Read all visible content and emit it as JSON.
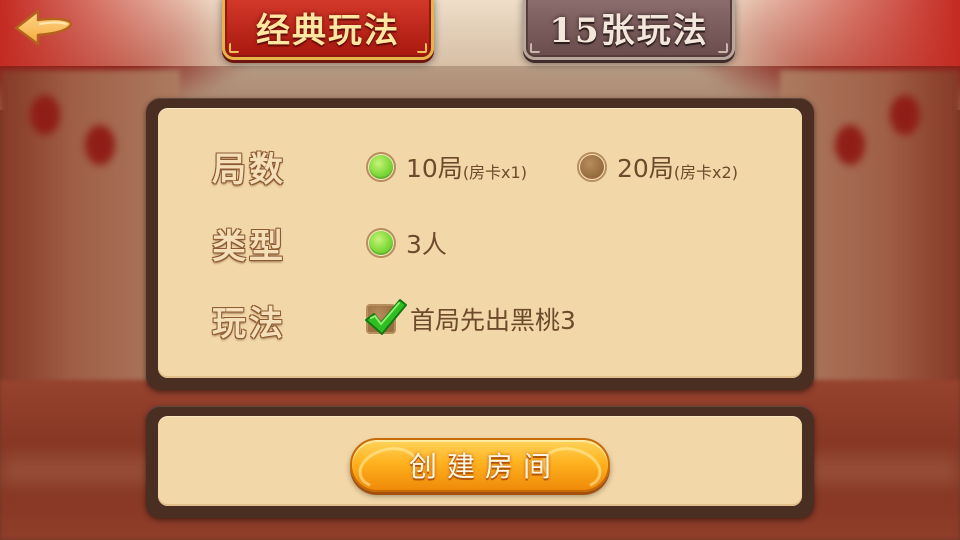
{
  "tabs": [
    {
      "label": "经典玩法",
      "state": "active"
    },
    {
      "label": "15张玩法",
      "state": "inactive"
    }
  ],
  "back_icon": "left-arrow-icon",
  "options": {
    "rounds": {
      "label": "局数",
      "choices": [
        {
          "text": "10局",
          "sub": "(房卡x1)",
          "selected": true
        },
        {
          "text": "20局",
          "sub": "(房卡x2)",
          "selected": false
        }
      ]
    },
    "type": {
      "label": "类型",
      "choices": [
        {
          "text": "3人",
          "selected": true
        }
      ]
    },
    "play": {
      "label": "玩法",
      "checkbox": {
        "text": "首局先出黑桃3",
        "checked": true
      }
    }
  },
  "create_button": {
    "label": "创建房间"
  },
  "colors": {
    "panel": "#f2d7a8",
    "panel_border": "#4a2e22",
    "selected_green": "#7dd93a",
    "active_tab_red": "#c42a22",
    "button_orange": "#ffb21f"
  }
}
